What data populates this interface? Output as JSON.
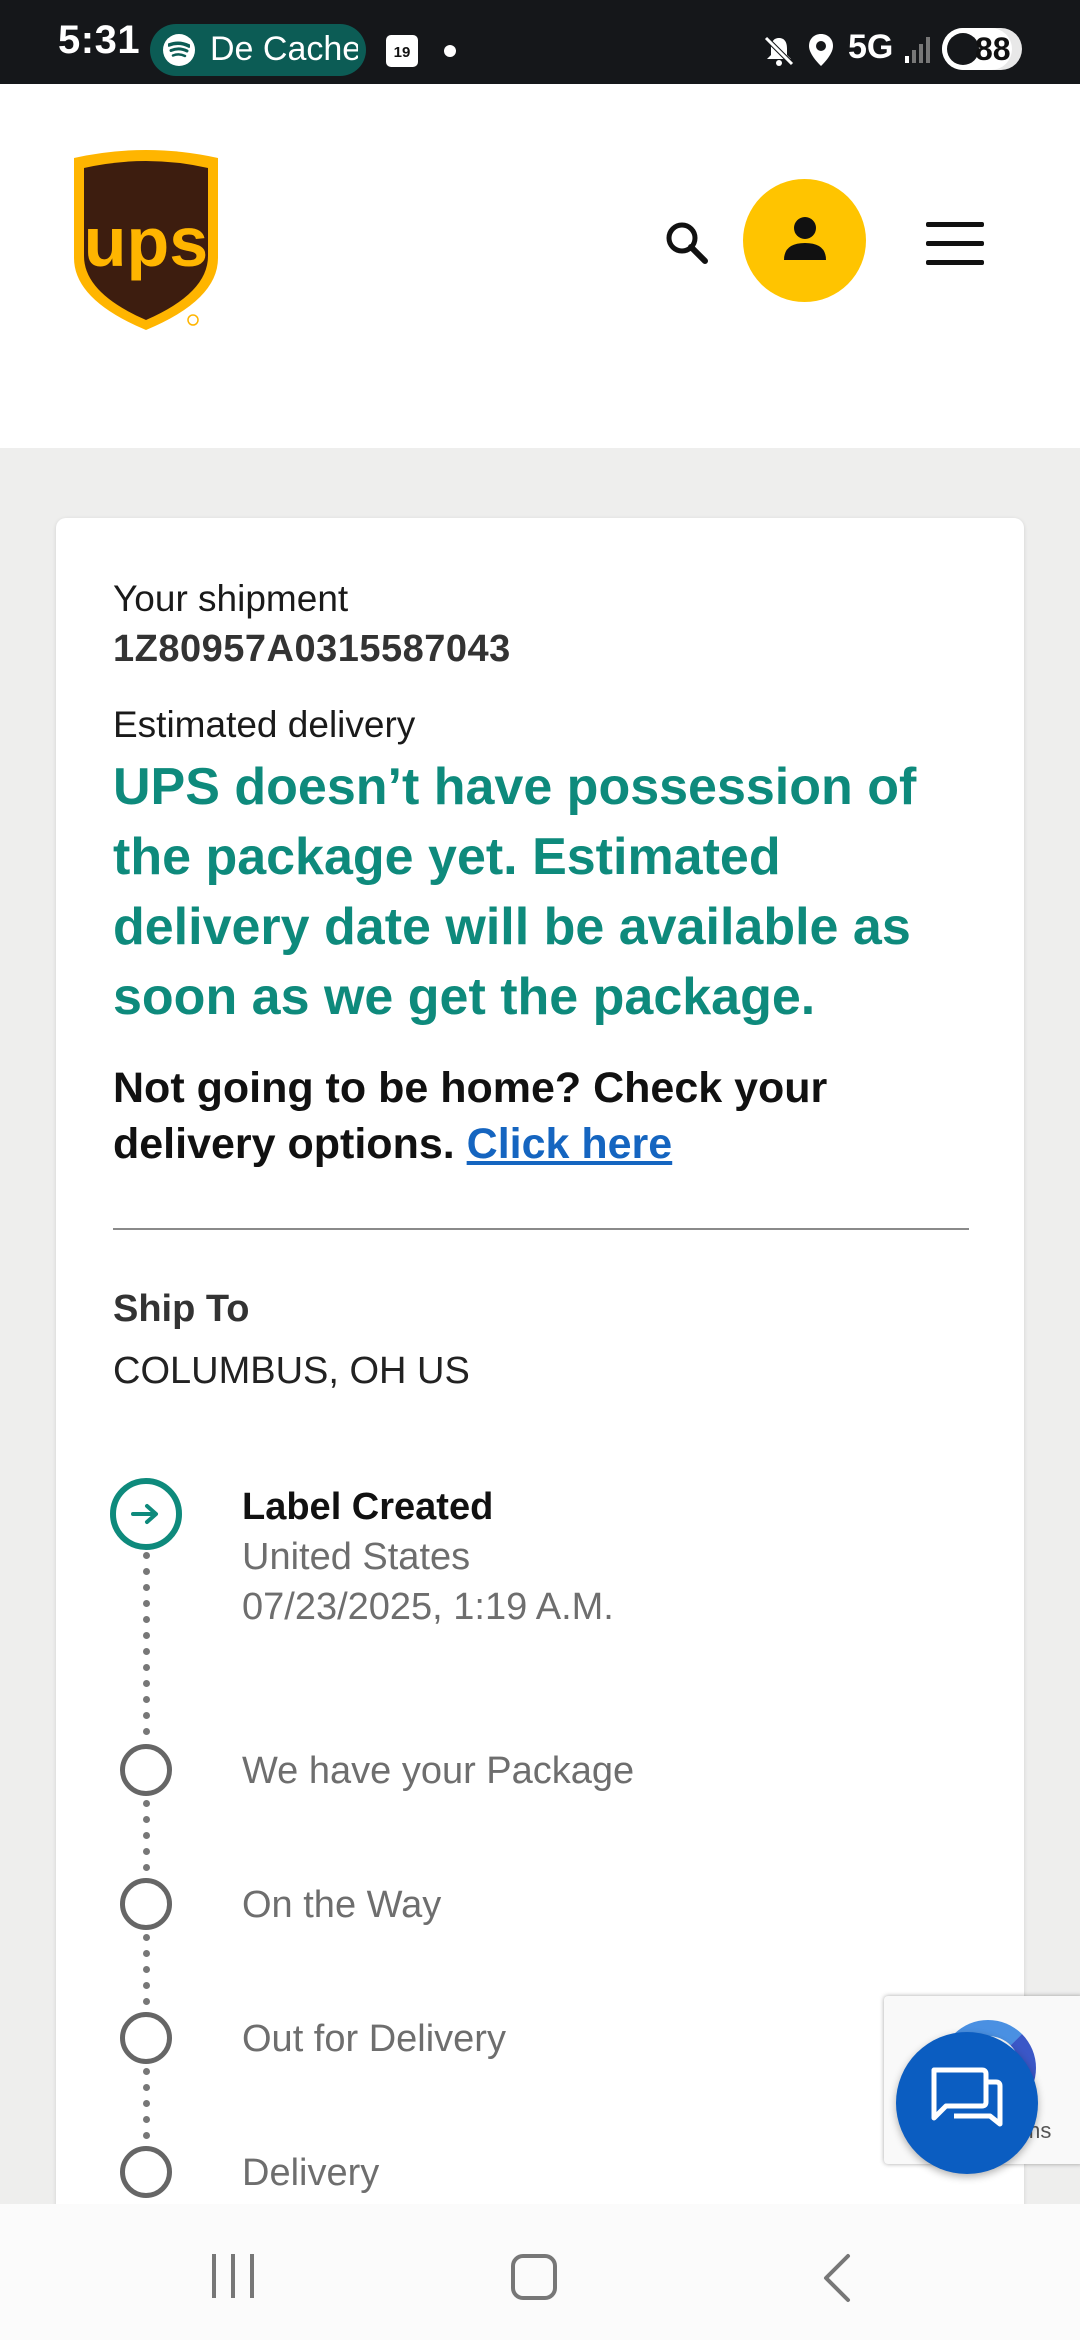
{
  "status_bar": {
    "time": "5:31",
    "now_playing": "De Cache",
    "calendar_day": "19",
    "network": "5G",
    "battery": "88",
    "icons": [
      "spotify-icon",
      "calendar-icon",
      "mute-icon",
      "location-icon",
      "signal-icon",
      "battery-icon"
    ]
  },
  "header": {
    "logo_text": "ups",
    "icons": [
      "search-icon",
      "account-icon",
      "menu-icon"
    ],
    "brand_colors": {
      "shield_brown": "#3d1d0f",
      "gold": "#ffb500",
      "account_yellow": "#ffc400"
    }
  },
  "shipment": {
    "label": "Your shipment",
    "tracking_number": "1Z80957A0315587043",
    "estimated_label": "Estimated delivery",
    "estimated_message": "UPS doesn’t have possession of the package yet. Estimated delivery date will be available as soon as we get the package.",
    "options_text": "Not going to be home? Check your delivery options.",
    "options_link": "Click here",
    "ship_to_label": "Ship To",
    "ship_to_value": "COLUMBUS, OH US"
  },
  "progress": {
    "current": {
      "title": "Label Created",
      "location": "United States",
      "datetime": "07/23/2025, 1:19 A.M."
    },
    "steps": [
      "We have your Package",
      "On the Way",
      "Out for Delivery",
      "Delivery"
    ]
  },
  "recaptcha": {
    "visible_text": "ms"
  },
  "colors": {
    "accent_teal": "#0e8a7c",
    "link_blue": "#1565c0",
    "chat_blue": "#0b5dc1"
  },
  "nav_bar": {
    "icons": [
      "recent-apps-icon",
      "home-icon",
      "back-icon"
    ]
  }
}
